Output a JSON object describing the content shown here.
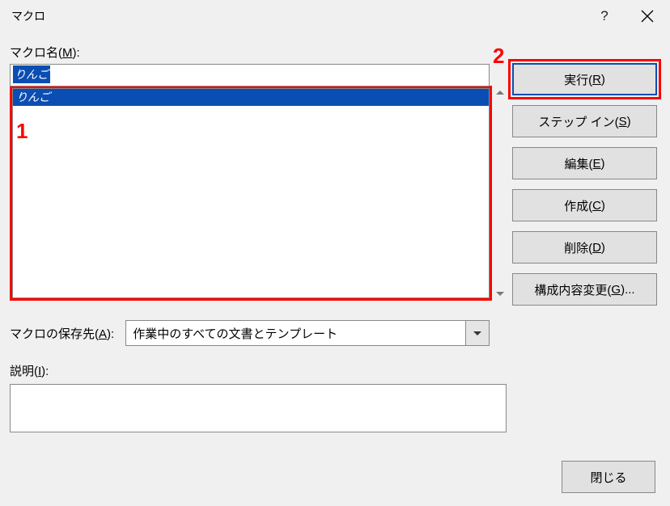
{
  "title": "マクロ",
  "helpSymbol": "?",
  "macroName": {
    "label_pre": "マクロ名(",
    "label_access": "M",
    "label_post": "):",
    "value": "りんご"
  },
  "list": {
    "items": [
      "りんご"
    ]
  },
  "buttons": {
    "run_pre": "実行(",
    "run_access": "R",
    "run_post": ")",
    "stepin_pre": "ステップ イン(",
    "stepin_access": "S",
    "stepin_post": ")",
    "edit_pre": "編集(",
    "edit_access": "E",
    "edit_post": ")",
    "create_pre": "作成(",
    "create_access": "C",
    "create_post": ")",
    "delete_pre": "削除(",
    "delete_access": "D",
    "delete_post": ")",
    "organize_pre": "構成内容変更(",
    "organize_access": "G",
    "organize_post": ")...",
    "close": "閉じる"
  },
  "saveIn": {
    "label_pre": "マクロの保存先(",
    "label_access": "A",
    "label_post": "):",
    "value": "作業中のすべての文書とテンプレート"
  },
  "description": {
    "label_pre": "説明(",
    "label_access": "I",
    "label_post": "):"
  },
  "annotations": {
    "one": "1",
    "two": "2"
  }
}
